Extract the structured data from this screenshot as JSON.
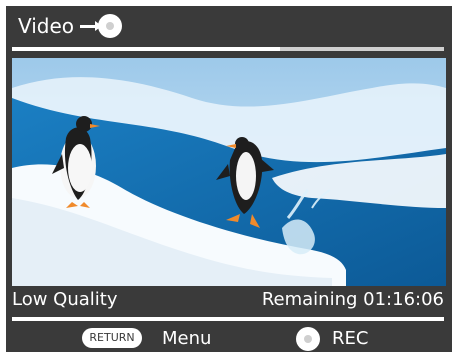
{
  "header": {
    "title": "Video",
    "source_icon": "disc-icon"
  },
  "playback": {
    "top_progress": 0.62,
    "bottom_progress": 1.0
  },
  "video": {
    "description_alt": "Penguin video frame"
  },
  "status": {
    "quality": "Low Quality",
    "remaining": "Remaining 01:16:06"
  },
  "controls": {
    "return_label": "RETURN",
    "menu_label": "Menu",
    "rec_label": "REC",
    "rec_icon": "record-disc-icon"
  },
  "colors": {
    "background": "#3a3a3a",
    "foreground": "#ffffff",
    "track": "#cfcfcf"
  }
}
